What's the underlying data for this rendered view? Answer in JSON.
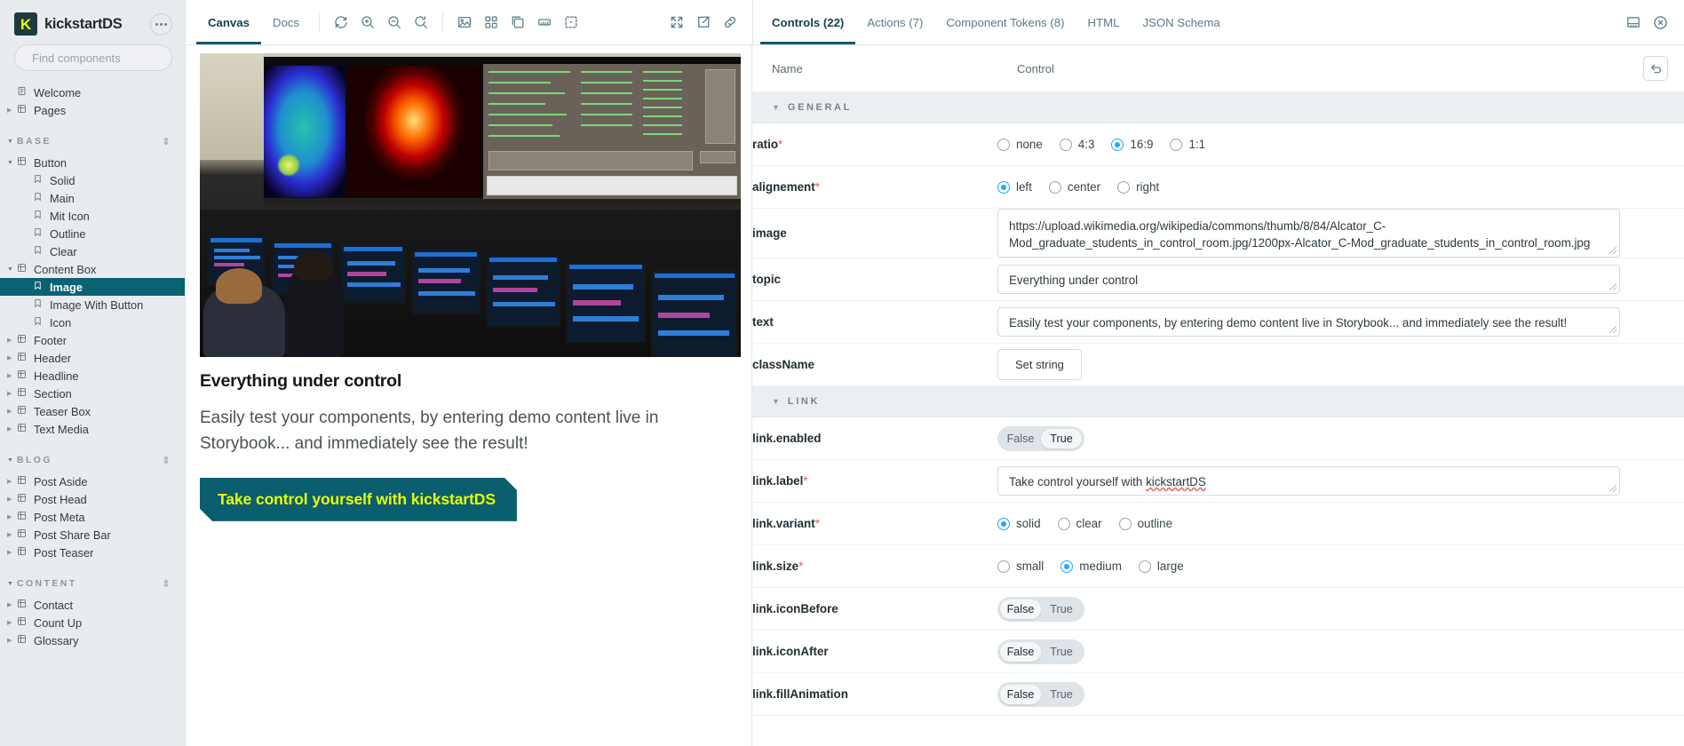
{
  "sidebar": {
    "brand": {
      "mark": "K",
      "name": "kickstartDS"
    },
    "menu_icon": "more-dots-icon",
    "search": {
      "placeholder": "Find components",
      "value": "",
      "shortcut": "/"
    },
    "top_items": [
      {
        "label": "Welcome",
        "icon": "document-icon",
        "expandable": false,
        "level": 0
      },
      {
        "label": "Pages",
        "icon": "component-icon",
        "expandable": true,
        "level": 0
      }
    ],
    "groups": [
      {
        "title": "BASE",
        "items": [
          {
            "label": "Button",
            "icon": "component-icon",
            "expandable": true,
            "expanded": true,
            "level": 0
          },
          {
            "label": "Solid",
            "icon": "story-icon",
            "level": 1
          },
          {
            "label": "Main",
            "icon": "story-icon",
            "level": 1
          },
          {
            "label": "Mit Icon",
            "icon": "story-icon",
            "level": 1
          },
          {
            "label": "Outline",
            "icon": "story-icon",
            "level": 1
          },
          {
            "label": "Clear",
            "icon": "story-icon",
            "level": 1
          },
          {
            "label": "Content Box",
            "icon": "component-icon",
            "expandable": true,
            "expanded": true,
            "level": 0
          },
          {
            "label": "Image",
            "icon": "story-icon",
            "level": 1,
            "selected": true
          },
          {
            "label": "Image With Button",
            "icon": "story-icon",
            "level": 1
          },
          {
            "label": "Icon",
            "icon": "story-icon",
            "level": 1
          },
          {
            "label": "Footer",
            "icon": "component-icon",
            "expandable": true,
            "level": 0
          },
          {
            "label": "Header",
            "icon": "component-icon",
            "expandable": true,
            "level": 0
          },
          {
            "label": "Headline",
            "icon": "component-icon",
            "expandable": true,
            "level": 0
          },
          {
            "label": "Section",
            "icon": "component-icon",
            "expandable": true,
            "level": 0
          },
          {
            "label": "Teaser Box",
            "icon": "component-icon",
            "expandable": true,
            "level": 0
          },
          {
            "label": "Text Media",
            "icon": "component-icon",
            "expandable": true,
            "level": 0
          }
        ]
      },
      {
        "title": "BLOG",
        "items": [
          {
            "label": "Post Aside",
            "icon": "component-icon",
            "expandable": true,
            "level": 0
          },
          {
            "label": "Post Head",
            "icon": "component-icon",
            "expandable": true,
            "level": 0
          },
          {
            "label": "Post Meta",
            "icon": "component-icon",
            "expandable": true,
            "level": 0
          },
          {
            "label": "Post Share Bar",
            "icon": "component-icon",
            "expandable": true,
            "level": 0
          },
          {
            "label": "Post Teaser",
            "icon": "component-icon",
            "expandable": true,
            "level": 0
          }
        ]
      },
      {
        "title": "CONTENT",
        "items": [
          {
            "label": "Contact",
            "icon": "component-icon",
            "expandable": true,
            "level": 0
          },
          {
            "label": "Count Up",
            "icon": "component-icon",
            "expandable": true,
            "level": 0
          },
          {
            "label": "Glossary",
            "icon": "component-icon",
            "expandable": true,
            "level": 0
          }
        ]
      }
    ]
  },
  "canvas_toolbar": {
    "tabs": [
      {
        "label": "Canvas",
        "active": true
      },
      {
        "label": "Docs",
        "active": false
      }
    ],
    "tools": [
      "remount-icon",
      "zoom-in-icon",
      "zoom-out-icon",
      "zoom-reset-icon",
      "backgrounds-icon",
      "grid-icon",
      "viewport-icon",
      "measure-icon",
      "outline-icon"
    ],
    "right_tools": [
      "fullscreen-icon",
      "open-new-tab-icon",
      "copy-link-icon"
    ]
  },
  "addon_panel": {
    "tabs": [
      {
        "label": "Controls (22)",
        "active": true
      },
      {
        "label": "Actions (7)",
        "active": false
      },
      {
        "label": "Component Tokens (8)",
        "active": false
      },
      {
        "label": "HTML",
        "active": false
      },
      {
        "label": "JSON Schema",
        "active": false
      }
    ],
    "right_tools": [
      "panel-position-icon",
      "close-panel-icon"
    ],
    "columns": {
      "name": "Name",
      "control": "Control"
    },
    "reset_icon": "reset-controls-icon",
    "sections": [
      {
        "title": "GENERAL",
        "rows": [
          {
            "name": "ratio",
            "required": true,
            "type": "radio",
            "options": [
              "none",
              "4:3",
              "16:9",
              "1:1"
            ],
            "value": "16:9"
          },
          {
            "name": "alignement",
            "required": true,
            "type": "radio",
            "options": [
              "left",
              "center",
              "right"
            ],
            "value": "left"
          },
          {
            "name": "image",
            "required": false,
            "type": "textarea",
            "value": "https://upload.wikimedia.org/wikipedia/commons/thumb/8/84/Alcator_C-Mod_graduate_students_in_control_room.jpg/1200px-Alcator_C-Mod_graduate_students_in_control_room.jpg"
          },
          {
            "name": "topic",
            "required": false,
            "type": "text",
            "value": "Everything under control"
          },
          {
            "name": "text",
            "required": false,
            "type": "text",
            "value": "Easily test your components, by entering demo content live in Storybook... and immediately see the result!"
          },
          {
            "name": "className",
            "required": false,
            "type": "button",
            "value": "Set string"
          }
        ]
      },
      {
        "title": "LINK",
        "rows": [
          {
            "name": "link.enabled",
            "required": false,
            "type": "toggle",
            "options": [
              "False",
              "True"
            ],
            "value": "True"
          },
          {
            "name": "link.label",
            "required": true,
            "type": "text",
            "value": "Take control yourself with kickstartDS"
          },
          {
            "name": "link.variant",
            "required": true,
            "type": "radio",
            "options": [
              "solid",
              "clear",
              "outline"
            ],
            "value": "solid"
          },
          {
            "name": "link.size",
            "required": true,
            "type": "radio",
            "options": [
              "small",
              "medium",
              "large"
            ],
            "value": "medium"
          },
          {
            "name": "link.iconBefore",
            "required": false,
            "type": "toggle",
            "options": [
              "False",
              "True"
            ],
            "value": "False"
          },
          {
            "name": "link.iconAfter",
            "required": false,
            "type": "toggle",
            "options": [
              "False",
              "True"
            ],
            "value": "False"
          },
          {
            "name": "link.fillAnimation",
            "required": false,
            "type": "toggle",
            "options": [
              "False",
              "True"
            ],
            "value": "False"
          }
        ]
      }
    ]
  },
  "preview": {
    "image_alt": "Alcator C-Mod graduate students in control room",
    "title": "Everything under control",
    "text": "Easily test your components, by entering demo content live in Storybook... and immediately see the result!",
    "cta_label": "Take control yourself with kickstartDS",
    "colors": {
      "cta_bg": "#0b5e6e",
      "cta_text": "#e8ff00",
      "accent": "#0e5c6d"
    }
  }
}
